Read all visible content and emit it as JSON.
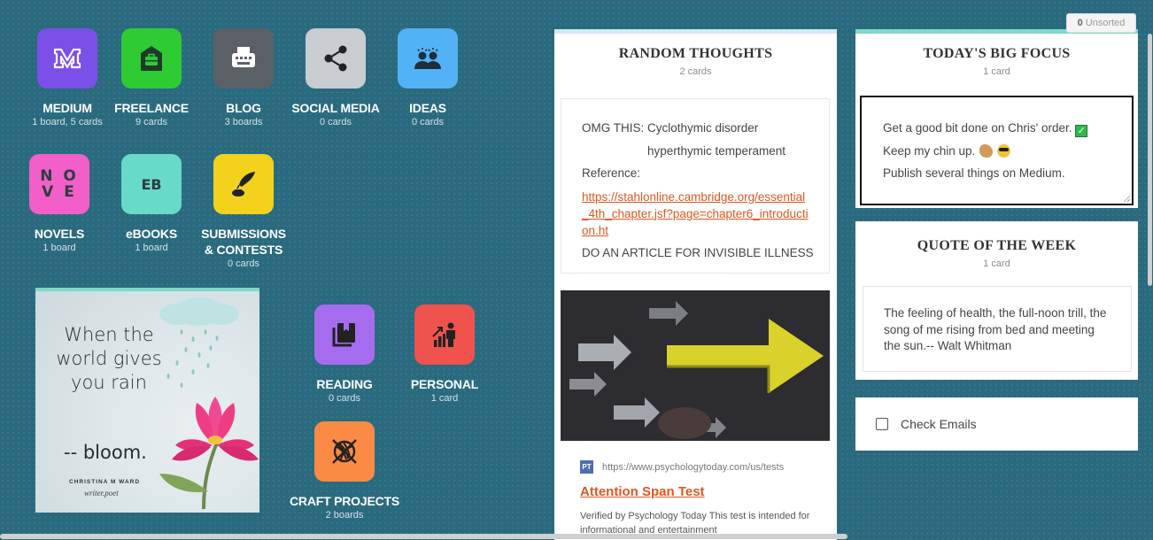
{
  "tiles": [
    {
      "name": "MEDIUM",
      "count": "1 board, 5 cards",
      "color": "#7b50e8",
      "icon": "medium-logo-icon"
    },
    {
      "name": "FREELANCE",
      "count": "9 cards",
      "color": "#2fcb34",
      "icon": "briefcase-house-icon"
    },
    {
      "name": "BLOG",
      "count": "3 boards",
      "color": "#5b6067",
      "icon": "typewriter-icon"
    },
    {
      "name": "SOCIAL MEDIA",
      "count": "0 cards",
      "color": "#c9ccd1",
      "icon": "share-icon"
    },
    {
      "name": "IDEAS",
      "count": "0 cards",
      "color": "#52b2f5",
      "icon": "people-idea-icon"
    },
    {
      "name": "NOVELS",
      "count": "1 board",
      "color": "#f25fc9",
      "icon_text": "N O\nV E"
    },
    {
      "name": "eBOOKS",
      "count": "1 board",
      "color": "#68dac9",
      "icon_text": "EB"
    },
    {
      "name": "SUBMISSIONS\n& CONTESTS",
      "count": "0 cards",
      "color": "#f2d21d",
      "icon": "quill-inkwell-icon"
    },
    {
      "name": "READING",
      "count": "0 cards",
      "color": "#a56cf0",
      "icon": "book-stack-icon"
    },
    {
      "name": "PERSONAL",
      "count": "1 card",
      "color": "#f0524e",
      "icon": "person-growth-icon"
    },
    {
      "name": "CRAFT PROJECTS",
      "count": "2 boards",
      "color": "#fb8a45",
      "icon": "yarn-icon"
    }
  ],
  "image_card": {
    "quote": "When the world gives you rain",
    "bloom": "-- bloom.",
    "author": "CHRISTINA M WARD",
    "tag": "writer.poet"
  },
  "random_thoughts": {
    "title": "RANDOM THOUGHTS",
    "count": "2 cards",
    "line1": "OMG THIS: Cyclothymic disorder",
    "line2": "hyperthymic temperament",
    "line3": "Reference:",
    "link": "https://stahlonline.cambridge.org/essential_4th_chapter.jsf?page=chapter6_introduction.ht",
    "line4": "DO AN ARTICLE FOR INVISIBLE ILLNESS",
    "stars": "****************************************",
    "link_card": {
      "favicon": "PT",
      "url": "https://www.psychologytoday.com/us/tests",
      "title": "Attention Span Test",
      "desc": "Verified by Psychology Today This test is intended for informational and entertainment"
    }
  },
  "big_focus": {
    "title": "TODAY'S BIG FOCUS",
    "count": "1 card",
    "line1": "Get a good bit done on Chris' order.",
    "line2": "Keep my chin up.",
    "line3": "Publish several things on Medium."
  },
  "quote_week": {
    "title": "QUOTE OF THE WEEK",
    "count": "1 card",
    "text": "The feeling of health, the full-noon trill, the song of me rising from bed and meeting the sun.-- Walt Whitman"
  },
  "todo": {
    "label": "Check Emails",
    "checked": false
  },
  "unsorted": {
    "count": "0",
    "label": "Unsorted"
  }
}
